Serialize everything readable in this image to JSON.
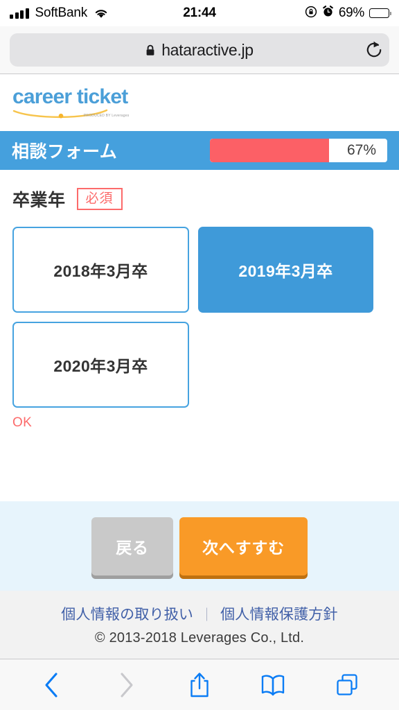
{
  "status_bar": {
    "carrier": "SoftBank",
    "time": "21:44",
    "battery_percent": "69%",
    "battery_level": 69,
    "icons": [
      "signal-bars-icon",
      "wifi-icon",
      "rotation-lock-icon",
      "alarm-clock-icon",
      "battery-icon"
    ]
  },
  "browser": {
    "url": "hataractive.jp",
    "secure": true,
    "lock_icon": "lock-icon",
    "reload_icon": "reload-icon"
  },
  "site": {
    "logo_text": "career ticket",
    "logo_tagline": "PRODUCED BY Leverages",
    "brand_blue": "#4b9fd8",
    "brand_orange": "#f7b52c"
  },
  "form_header": {
    "title": "相談フォーム",
    "progress_percent": 67,
    "progress_label": "67%",
    "bar_color": "#45a0dd",
    "progress_fill_color": "#fc6066"
  },
  "question": {
    "label": "卒業年",
    "required_badge": "必須",
    "required_color": "#fc6a6a",
    "options": [
      {
        "label": "2018年3月卒",
        "selected": false
      },
      {
        "label": "2019年3月卒",
        "selected": true
      },
      {
        "label": "2020年3月卒",
        "selected": false
      }
    ],
    "validation_message": "OK",
    "validation_color": "#fc6a6a",
    "selected_color": "#3f9ad9"
  },
  "actions": {
    "back_label": "戻る",
    "next_label": "次へすすむ",
    "back_color": "#c9c9c9",
    "next_color": "#f99a27",
    "section_bg": "#e7f4fc"
  },
  "footer": {
    "link_privacy_handling": "個人情報の取り扱い",
    "separator": "｜",
    "link_privacy_policy": "個人情報保護方針",
    "copyright": "© 2013-2018 Leverages Co., Ltd.",
    "link_color": "#4160a8"
  },
  "safari_toolbar": {
    "items": [
      {
        "name": "back-button",
        "icon": "chevron-left-icon",
        "enabled": true
      },
      {
        "name": "forward-button",
        "icon": "chevron-right-icon",
        "enabled": false
      },
      {
        "name": "share-button",
        "icon": "share-icon",
        "enabled": true
      },
      {
        "name": "bookmarks-button",
        "icon": "book-icon",
        "enabled": true
      },
      {
        "name": "tabs-button",
        "icon": "tabs-icon",
        "enabled": true
      }
    ],
    "active_color": "#0a7cf5",
    "disabled_color": "#c8c8cc"
  }
}
